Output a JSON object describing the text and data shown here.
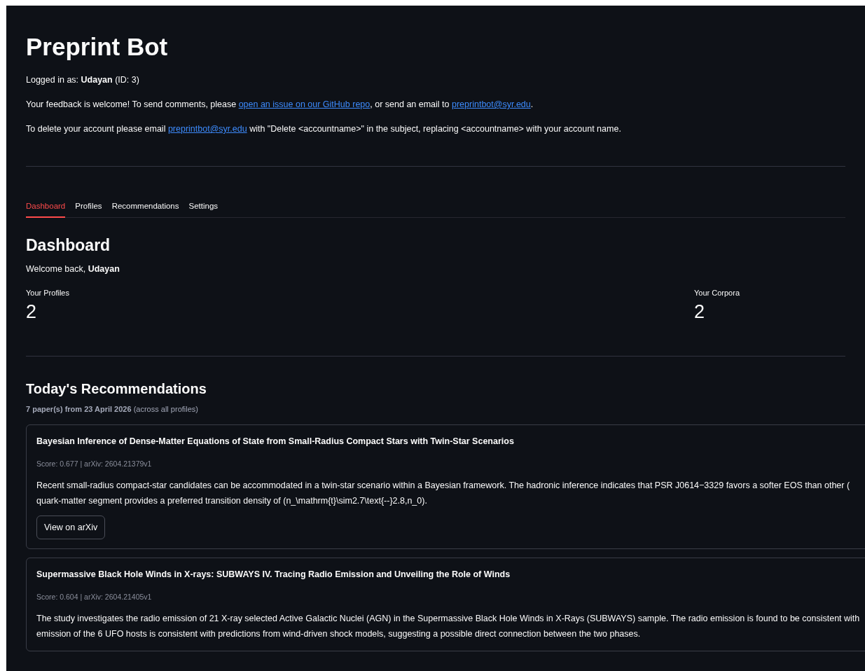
{
  "app": {
    "title": "Preprint Bot"
  },
  "intro": [
    "Logged in as: **Udayan** (ID: 3)"
  ],
  "feedback": {
    "before": "Your feedback is welcome! To send comments, please ",
    "link1": "open an issue on our GitHub repo",
    "middle": ", or send an email to ",
    "link2": "preprintbot@syr.edu",
    "after": "."
  },
  "delete_note": {
    "before": "To delete your account please email ",
    "link": "preprintbot@syr.edu",
    "after": " with \"Delete <accountname>\" in the subject, replacing <accountname> with your account name."
  },
  "tabs": [
    {
      "label": "Dashboard",
      "selected": true
    },
    {
      "label": "Profiles",
      "selected": false
    },
    {
      "label": "Recommendations",
      "selected": false
    },
    {
      "label": "Settings",
      "selected": false
    }
  ],
  "dashboard": {
    "heading": "Dashboard",
    "welcome": "Welcome back, **Udayan**",
    "metrics": [
      {
        "label": "Your Profiles",
        "value": "2"
      },
      {
        "label": "Your Corpora",
        "value": "2"
      }
    ]
  },
  "recommendations": {
    "heading": "Today's Recommendations",
    "subtitle": "**7 paper(s) from 23 April 2026** (across all profiles)",
    "papers": [
      {
        "title": "Bayesian Inference of Dense-Matter Equations of State from Small-Radius Compact Stars with Twin-Star Scenarios",
        "meta": "Score: 0.677 | arXiv: 2604.21379v1",
        "summary_lines": [
          "Recent small-radius compact-star candidates can be accommodated in a twin-star scenario within a Bayesian framework. The hadronic inference indicates that PSR J0614−3329 favors a softer EOS than other (",
          "quark-matter segment provides a preferred transition density of (n_\\mathrm{t}\\sim2.7\\text{--}2.8,n_0)."
        ],
        "button": "View on arXiv"
      },
      {
        "title": "Supermassive Black Hole Winds in X-rays: SUBWAYS IV. Tracing Radio Emission and Unveiling the Role of Winds",
        "meta": "Score: 0.604 | arXiv: 2604.21405v1",
        "summary_lines": [
          "The study investigates the radio emission of 21 X-ray selected Active Galactic Nuclei (AGN) in the Supermassive Black Hole Winds in X-Rays (SUBWAYS) sample. The radio emission is found to be consistent with",
          "emission of the 6 UFO hosts is consistent with predictions from wind-driven shock models, suggesting a possible direct connection between the two phases."
        ]
      }
    ]
  }
}
